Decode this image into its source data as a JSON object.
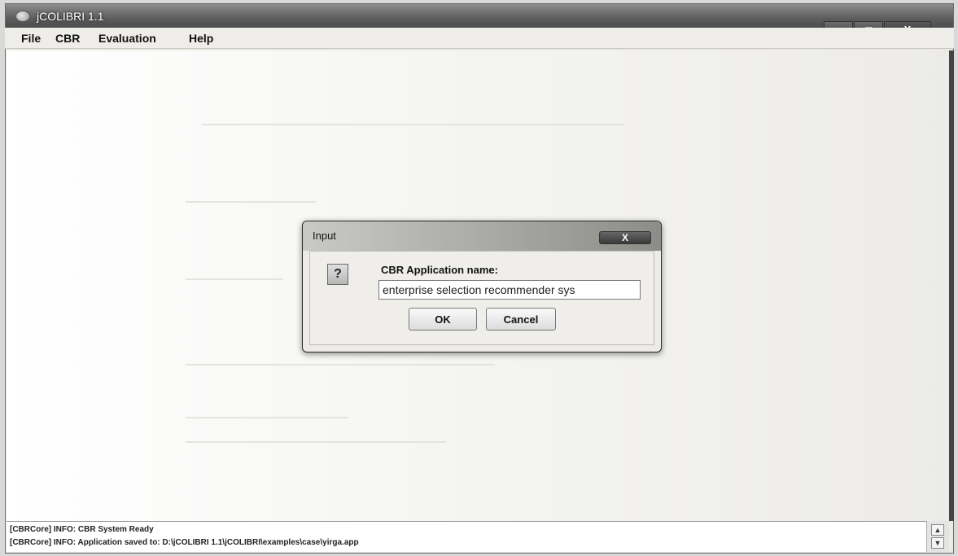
{
  "window": {
    "title": "jCOLIBRI 1.1"
  },
  "window_controls": {
    "minimize": "—",
    "maximize": "□",
    "close": "X"
  },
  "menubar": {
    "items": [
      "File",
      "CBR",
      "Evaluation",
      "Help"
    ]
  },
  "dialog": {
    "title": "Input",
    "close": "X",
    "icon": "question-icon",
    "icon_glyph": "?",
    "prompt": "CBR Application name:",
    "input_value": "enterprise selection recommender sys",
    "ok_label": "OK",
    "cancel_label": "Cancel"
  },
  "log": {
    "lines": [
      "[CBRCore] INFO: CBR System Ready",
      "[CBRCore] INFO: Application saved to: D:\\jCOLIBRI 1.1\\jCOLIBRI\\examples\\case\\yirga.app"
    ]
  }
}
